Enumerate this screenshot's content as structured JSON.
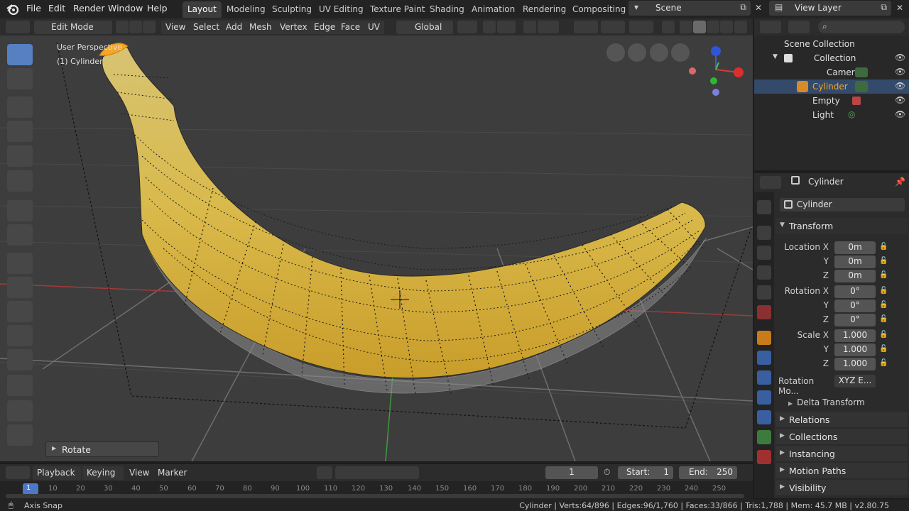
{
  "menu": {
    "items": [
      "File",
      "Edit",
      "Render",
      "Window",
      "Help"
    ]
  },
  "workspaces": {
    "tabs": [
      "Layout",
      "Modeling",
      "Sculpting",
      "UV Editing",
      "Texture Paint",
      "Shading",
      "Animation",
      "Rendering",
      "Compositing"
    ],
    "active": "Layout"
  },
  "scene": {
    "name": "Scene",
    "view_layer": "View Layer"
  },
  "viewport_header": {
    "mode": "Edit Mode",
    "menus": [
      "View",
      "Select",
      "Add",
      "Mesh",
      "Vertex",
      "Edge",
      "Face",
      "UV"
    ],
    "orientation": "Global"
  },
  "viewport": {
    "overlay_title": "User Perspective",
    "overlay_object": "(1) Cylinder",
    "last_operator": "Rotate"
  },
  "outliner": {
    "root": "Scene Collection",
    "collection": "Collection",
    "items": [
      "Camera",
      "Cylinder",
      "Empty",
      "Light"
    ],
    "selected": "Cylinder"
  },
  "properties": {
    "object_name": "Cylinder",
    "datablock": "Cylinder",
    "transform_title": "Transform",
    "location_label": "Location X",
    "rotation_label": "Rotation X",
    "scale_label": "Scale X",
    "y_label": "Y",
    "z_label": "Z",
    "location": [
      "0m",
      "0m",
      "0m"
    ],
    "rotation": [
      "0°",
      "0°",
      "0°"
    ],
    "scale": [
      "1.000",
      "1.000",
      "1.000"
    ],
    "rotation_mode_label": "Rotation Mo...",
    "rotation_mode": "XYZ E...",
    "delta": "Delta Transform",
    "panels": [
      "Relations",
      "Collections",
      "Instancing",
      "Motion Paths",
      "Visibility"
    ]
  },
  "timeline": {
    "menus": [
      "Playback",
      "Keying",
      "View",
      "Marker"
    ],
    "current_frame": "1",
    "start_label": "Start:",
    "start": "1",
    "end_label": "End:",
    "end": "250",
    "ruler": [
      "1",
      "10",
      "20",
      "30",
      "40",
      "50",
      "60",
      "70",
      "80",
      "90",
      "100",
      "110",
      "120",
      "130",
      "140",
      "150",
      "160",
      "170",
      "180",
      "190",
      "200",
      "210",
      "220",
      "230",
      "240",
      "250"
    ]
  },
  "status": {
    "left": "Axis Snap",
    "right": "Cylinder | Verts:64/896 | Edges:96/1,760 | Faces:33/866 | Tris:1,788 | Mem: 45.7 MB | v2.80.75"
  },
  "colors": {
    "accent": "#5680c2",
    "selected_orange": "#f5a623",
    "banana": "#d9b94a"
  }
}
